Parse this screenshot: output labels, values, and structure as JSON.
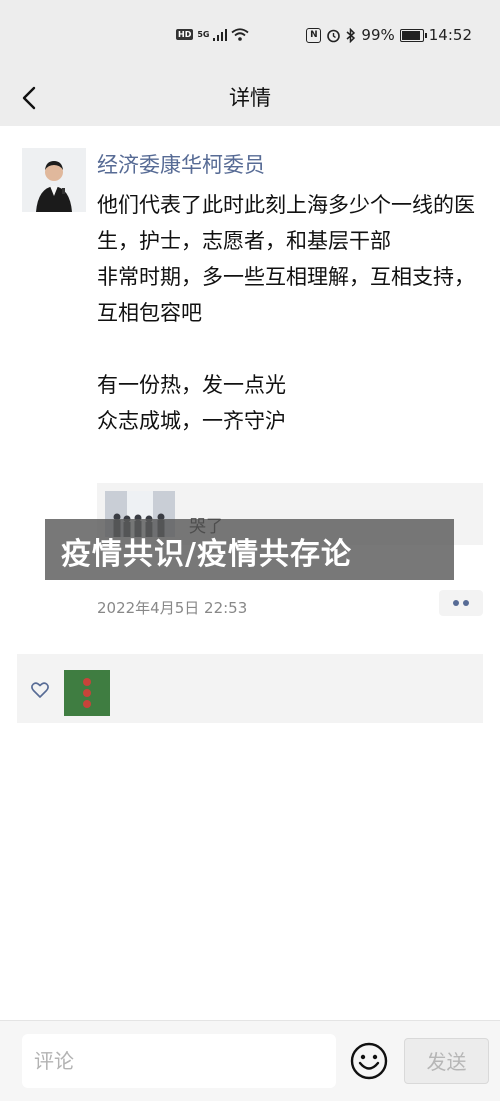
{
  "status_bar": {
    "network_badge": "HD",
    "signal_label": "5G",
    "battery": "99%",
    "time": "14:52",
    "battery_level": 0.99
  },
  "header": {
    "title": "详情",
    "back_icon": "chevron-left-icon"
  },
  "post": {
    "author": "经济委康华柯委员",
    "text": "他们代表了此时此刻上海多少个一线的医生，护士，志愿者，和基层干部\n非常时期，多一些互相理解，互相支持，互相包容吧\n\n有一份热，发一点光\n众志成城，一齐守沪",
    "share_card": {
      "title": "哭了"
    },
    "overlay_title": "疫情共识/疫情共存论",
    "timestamp": "2022年4月5日 22:53"
  },
  "likes": {
    "heart_icon": "heart-outline-icon"
  },
  "comment_bar": {
    "placeholder": "评论",
    "send_label": "发送",
    "emoji_icon": "emoji-icon"
  },
  "colors": {
    "link_blue": "#576b95",
    "header_bg": "#ededed",
    "panel_bg": "#f3f3f3",
    "muted_text": "#888888"
  }
}
